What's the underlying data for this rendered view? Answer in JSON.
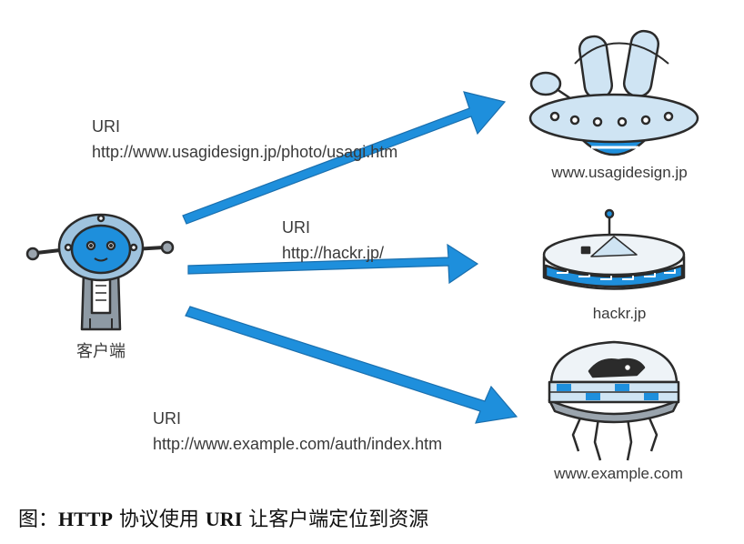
{
  "client": {
    "label": "客户端"
  },
  "requests": [
    {
      "heading": "URI",
      "uri": "http://www.usagidesign.jp/photo/usagi.htm"
    },
    {
      "heading": "URI",
      "uri": "http://hackr.jp/"
    },
    {
      "heading": "URI",
      "uri": "http://www.example.com/auth/index.htm"
    }
  ],
  "servers": [
    {
      "label": "www.usagidesign.jp"
    },
    {
      "label": "hackr.jp"
    },
    {
      "label": "www.example.com"
    }
  ],
  "caption": {
    "prefix": "图：",
    "b1": "HTTP",
    "t1": " 协议使用 ",
    "b2": "URI",
    "t2": " 让客户端定位到资源"
  },
  "colors": {
    "arrow": "#1e8fdc",
    "accent": "#7fb6dd",
    "ink": "#2b2b2b"
  }
}
